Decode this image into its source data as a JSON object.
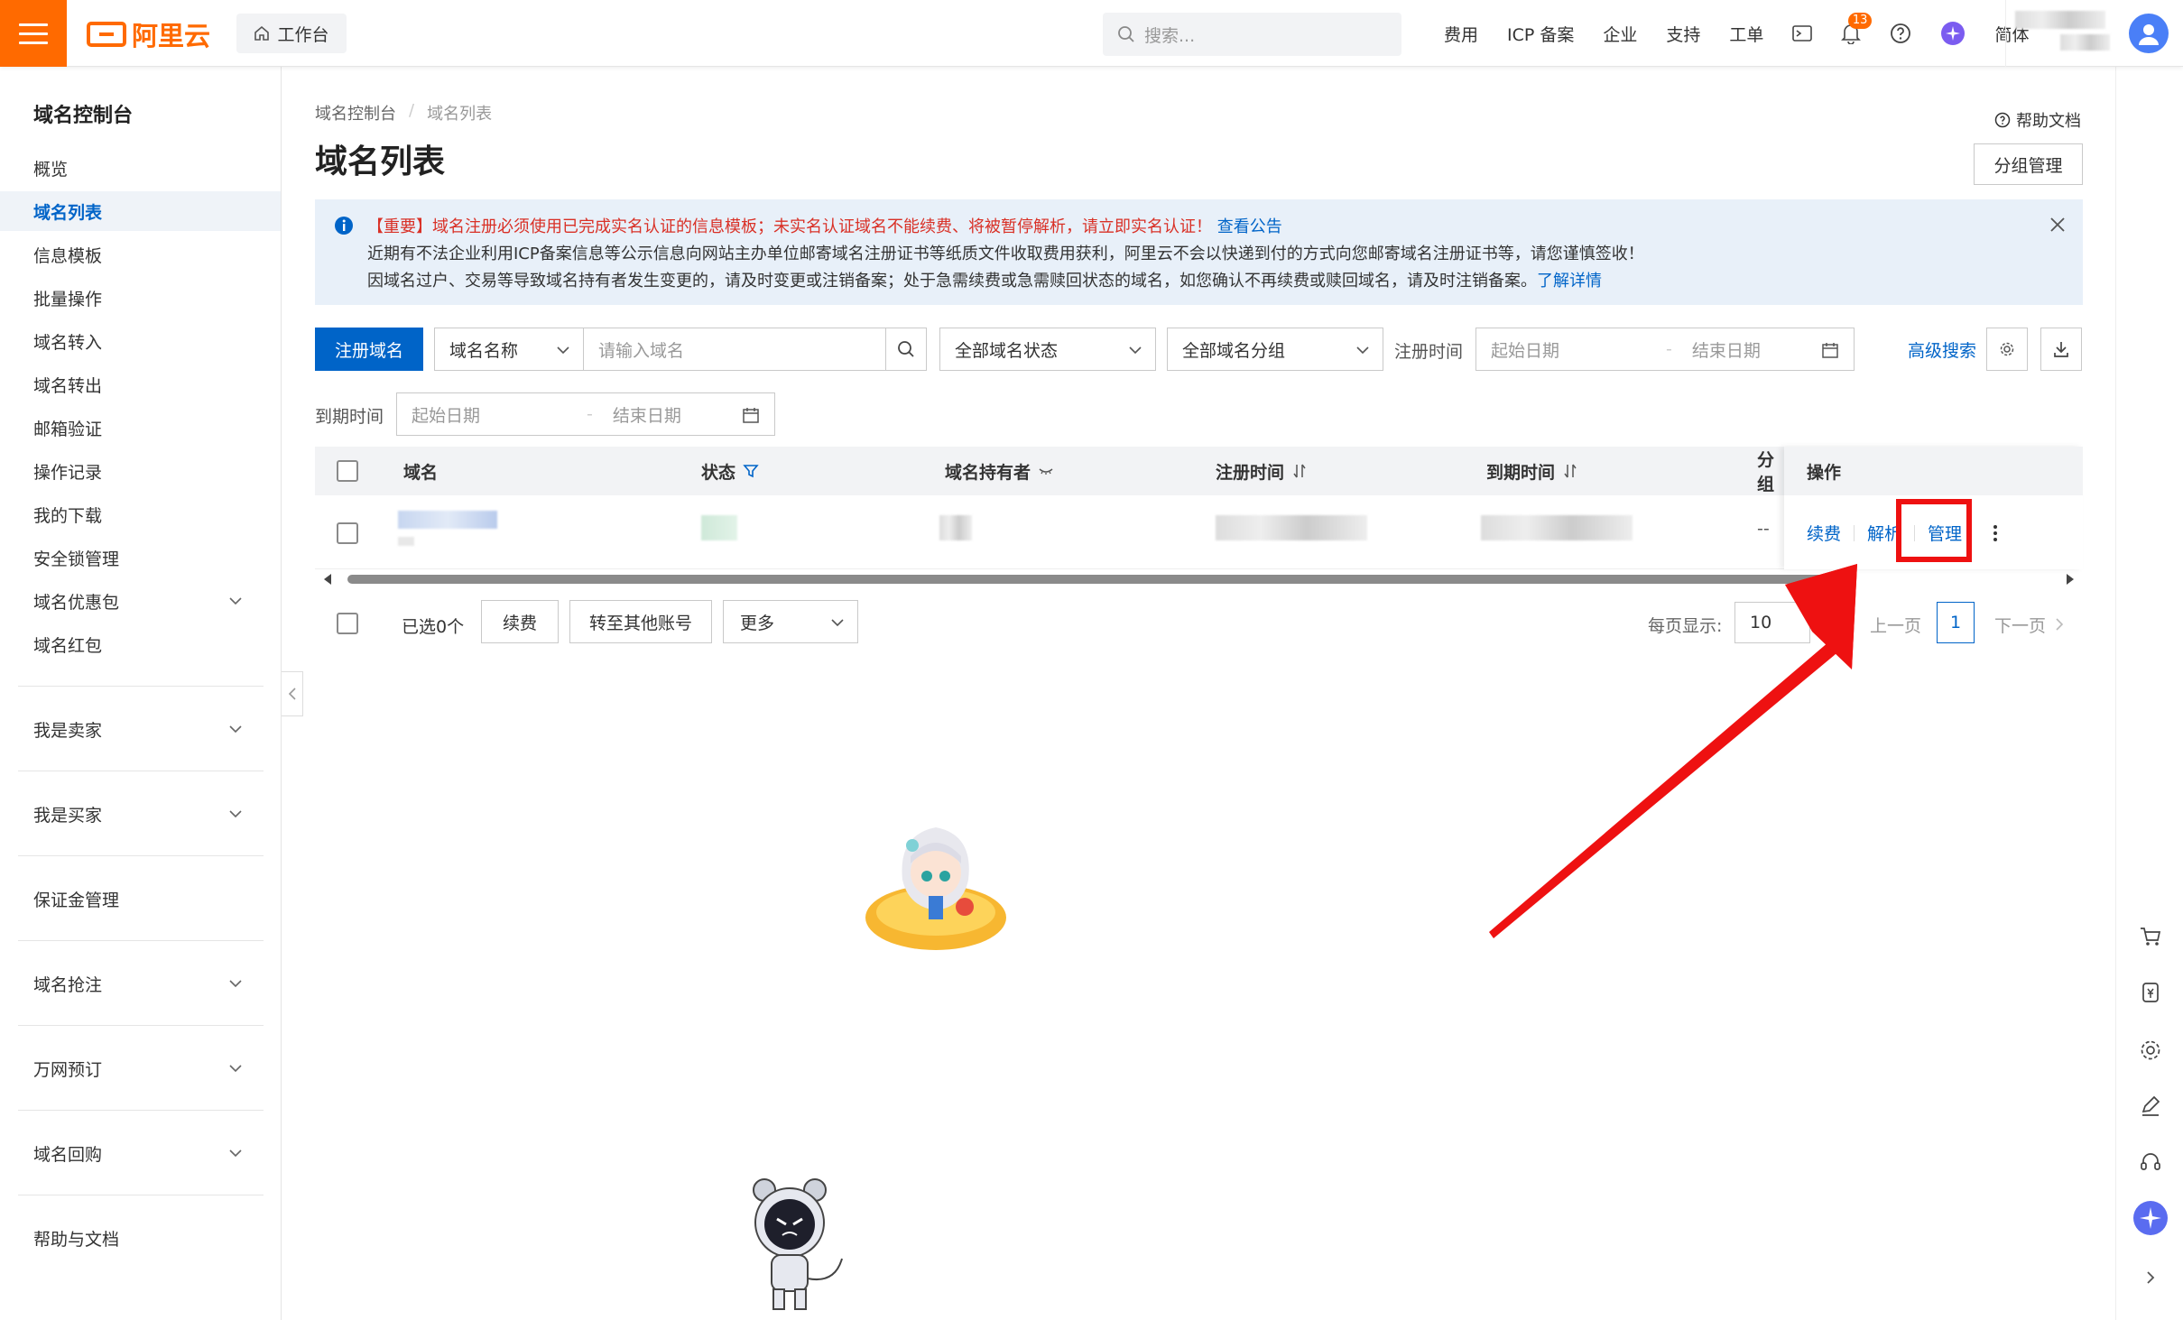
{
  "topbar": {
    "brand": "阿里云",
    "workbench": "工作台",
    "search_placeholder": "搜索...",
    "nav": [
      "费用",
      "ICP 备案",
      "企业",
      "支持",
      "工单"
    ],
    "notification_count": "13",
    "lang": "简体"
  },
  "sidebar": {
    "title": "域名控制台",
    "items": [
      "概览",
      "域名列表",
      "信息模板",
      "批量操作",
      "域名转入",
      "域名转出",
      "邮箱验证",
      "操作记录",
      "我的下载",
      "安全锁管理",
      "域名优惠包",
      "域名红包"
    ],
    "groups": [
      "我是卖家",
      "我是买家",
      "保证金管理",
      "域名抢注",
      "万网预订",
      "域名回购",
      "帮助与文档"
    ]
  },
  "breadcrumb": {
    "root": "域名控制台",
    "current": "域名列表"
  },
  "page": {
    "title": "域名列表",
    "help_doc": "帮助文档",
    "group_manage": "分组管理"
  },
  "notice": {
    "line1_red": "【重要】域名注册必须使用已完成实名认证的信息模板；未实名认证域名不能续费、将被暂停解析，请立即实名认证！",
    "line1_link": "查看公告",
    "line2": "近期有不法企业利用ICP备案信息等公示信息向网站主办单位邮寄域名注册证书等纸质文件收取费用获利，阿里云不会以快递到付的方式向您邮寄域名注册证书等，请您谨慎签收！",
    "line3": "因域名过户、交易等导致域名持有者发生变更的，请及时变更或注销备案；处于急需续费或急需赎回状态的域名，如您确认不再续费或赎回域名，请及时注销备案。",
    "line3_link": "了解详情"
  },
  "filters": {
    "register_btn": "注册域名",
    "name_select": "域名名称",
    "domain_placeholder": "请输入域名",
    "status_select": "全部域名状态",
    "group_select": "全部域名分组",
    "reg_time_label": "注册时间",
    "start_date": "起始日期",
    "end_date": "结束日期",
    "adv_search": "高级搜索",
    "expire_label": "到期时间"
  },
  "table": {
    "headers": {
      "domain": "域名",
      "status": "状态",
      "owner": "域名持有者",
      "reg_time": "注册时间",
      "expire_time": "到期时间",
      "group": "分组",
      "ops": "操作"
    },
    "row": {
      "group": "--",
      "renew": "续费",
      "dns": "解析",
      "manage": "管理"
    }
  },
  "footer": {
    "selected": "已选0个",
    "renew": "续费",
    "transfer": "转至其他账号",
    "more": "更多",
    "per_page_label": "每页显示:",
    "per_page": "10",
    "prev": "上一页",
    "page": "1",
    "next": "下一页"
  },
  "colors": {
    "accent": "#0064c8",
    "brand": "#ff6a00",
    "highlight": "#ee1111"
  }
}
